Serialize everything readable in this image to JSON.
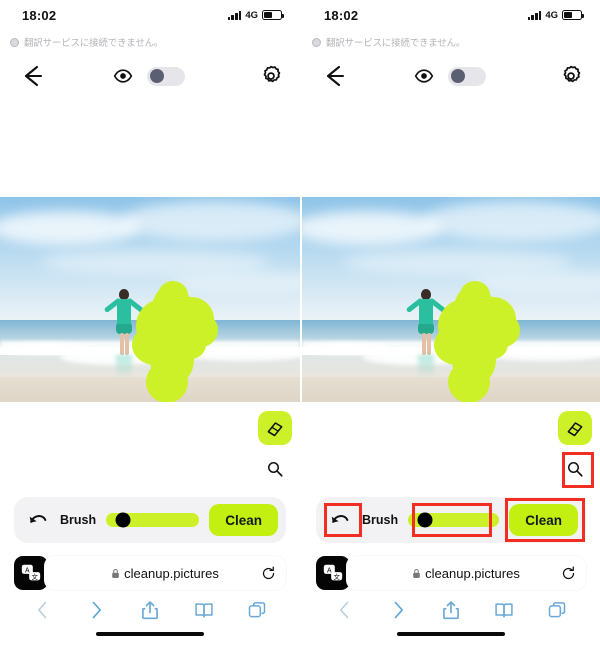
{
  "status_bar": {
    "time": "18:02",
    "network": "4G",
    "signal_icon": "signal-bars-icon",
    "battery_icon": "battery-icon"
  },
  "notice": {
    "icon": "info-circle-icon",
    "text": "翻訳サービスに接続できません。"
  },
  "app_toolbar": {
    "back_icon": "back-arrow-icon",
    "eye_icon": "eye-icon",
    "toggle_name": "compare-toggle",
    "toggle_state": "off",
    "settings_icon": "gear-icon"
  },
  "photo": {
    "alt": "woman-on-beach-with-arms-raised",
    "mask_color": "#ccf129"
  },
  "tools": {
    "eraser_icon": "eraser-icon",
    "eraser_bg": "#ccf129",
    "zoom_icon": "magnifier-icon"
  },
  "controls": {
    "undo_icon": "undo-arrow-icon",
    "brush_label": "Brush",
    "brush_value": 18,
    "slider_color": "#ccf129",
    "clean_label": "Clean",
    "clean_color": "#c3f011"
  },
  "browser": {
    "translate_icon": "translate-icon",
    "lock_icon": "lock-icon",
    "url": "cleanup.pictures",
    "reload_icon": "reload-icon",
    "nav": {
      "back_icon": "chevron-left-icon",
      "forward_icon": "chevron-right-icon",
      "share_icon": "share-icon",
      "bookmarks_icon": "book-icon",
      "tabs_icon": "tabs-icon"
    }
  },
  "annotations": {
    "boxes": [
      "zoom-button",
      "undo-button",
      "brush-slider",
      "clean-button"
    ],
    "color": "#f02e21"
  }
}
